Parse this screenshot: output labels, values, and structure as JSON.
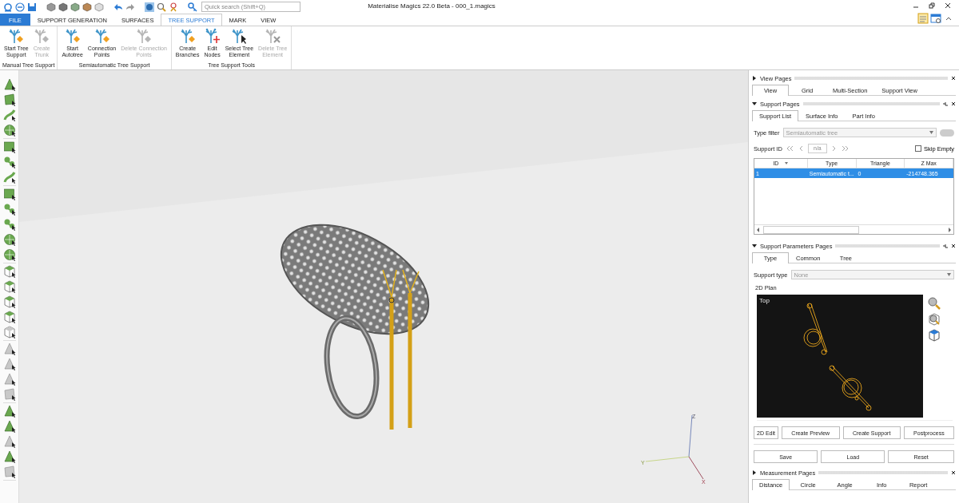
{
  "window": {
    "title": "Materialise Magics 22.0 Beta - 000_1.magics"
  },
  "quick_search": {
    "placeholder": "Quick search (Shift+Q)"
  },
  "ribbon_tabs": [
    {
      "label": "FILE",
      "selected": false,
      "kind": "file"
    },
    {
      "label": "SUPPORT GENERATION",
      "selected": false,
      "kind": "tab"
    },
    {
      "label": "SURFACES",
      "selected": false,
      "kind": "tab"
    },
    {
      "label": "TREE SUPPORT",
      "selected": true,
      "kind": "tab"
    },
    {
      "label": "MARK",
      "selected": false,
      "kind": "tab"
    },
    {
      "label": "VIEW",
      "selected": false,
      "kind": "tab"
    }
  ],
  "ribbon_groups": [
    {
      "label": "Manual Tree Support",
      "buttons": [
        {
          "label": "Start Tree\nSupport",
          "disabled": false,
          "kind": "add"
        },
        {
          "label": "Create\nTrunk",
          "disabled": true,
          "kind": "add"
        }
      ]
    },
    {
      "label": "Semiautomatic Tree Support",
      "buttons": [
        {
          "label": "Start\nAutotree",
          "disabled": false,
          "kind": "add"
        },
        {
          "label": "Connection\nPoints",
          "disabled": false,
          "kind": "add"
        },
        {
          "label": "Delete Connection\nPoints",
          "disabled": true,
          "kind": "add"
        }
      ]
    },
    {
      "label": "Tree Support Tools",
      "buttons": [
        {
          "label": "Create\nBranches",
          "disabled": false,
          "kind": "add"
        },
        {
          "label": "Edit\nNodes",
          "disabled": false,
          "kind": "edit"
        },
        {
          "label": "Select Tree\nElement",
          "disabled": false,
          "kind": "select"
        },
        {
          "label": "Delete Tree\nElement",
          "disabled": true,
          "kind": "delete"
        }
      ]
    }
  ],
  "left_toolbar": [
    [
      {
        "kind": "triangle",
        "disabled": false
      },
      {
        "kind": "quad",
        "disabled": false
      },
      {
        "kind": "curve",
        "disabled": false
      },
      {
        "kind": "circle",
        "disabled": false
      }
    ],
    [
      {
        "kind": "square",
        "disabled": false
      },
      {
        "kind": "node",
        "disabled": false
      },
      {
        "kind": "curve",
        "disabled": false
      }
    ],
    [
      {
        "kind": "square",
        "disabled": false
      },
      {
        "kind": "node",
        "disabled": false
      },
      {
        "kind": "node",
        "disabled": false
      },
      {
        "kind": "circle",
        "disabled": false
      },
      {
        "kind": "circle",
        "disabled": false
      }
    ],
    [
      {
        "kind": "cube",
        "disabled": false
      },
      {
        "kind": "cube",
        "disabled": false
      },
      {
        "kind": "cube",
        "disabled": false
      },
      {
        "kind": "cube",
        "disabled": false
      },
      {
        "kind": "cube",
        "disabled": true
      }
    ],
    [
      {
        "kind": "triangle",
        "disabled": true
      },
      {
        "kind": "triangle",
        "disabled": true
      },
      {
        "kind": "triangle",
        "disabled": true
      },
      {
        "kind": "quad",
        "disabled": true
      }
    ],
    [
      {
        "kind": "triangle",
        "disabled": false
      },
      {
        "kind": "triangle",
        "disabled": false
      },
      {
        "kind": "triangle",
        "disabled": true
      },
      {
        "kind": "triangle",
        "disabled": false
      },
      {
        "kind": "quad",
        "disabled": true
      }
    ]
  ],
  "viewport": {
    "axis_labels": {
      "z": "Z",
      "y": "Y",
      "x": "X"
    }
  },
  "view_pages": {
    "title": "View Pages",
    "expanded": false,
    "tabs": [
      {
        "label": "View",
        "selected": true
      },
      {
        "label": "Grid",
        "selected": false
      },
      {
        "label": "Multi-Section",
        "selected": false
      },
      {
        "label": "Support View",
        "selected": false
      }
    ]
  },
  "support_pages": {
    "title": "Support Pages",
    "expanded": true,
    "tabs": [
      {
        "label": "Support List",
        "selected": true
      },
      {
        "label": "Surface Info",
        "selected": false
      },
      {
        "label": "Part Info",
        "selected": false
      }
    ],
    "type_filter": {
      "label": "Type filter",
      "value": "Semiautomatic tree",
      "disabled": true,
      "toggle_on": false
    },
    "support_id": {
      "label": "Support ID",
      "value": "n/a"
    },
    "skip_empty": {
      "label": "Skip Empty",
      "checked": false
    },
    "table": {
      "columns": [
        "ID",
        "Type",
        "Triangle",
        "Z Max"
      ],
      "rows": [
        {
          "cells": [
            "1",
            "Semiautomatic t...",
            "0",
            "-214748.365"
          ],
          "selected": true
        }
      ]
    }
  },
  "support_parameters_pages": {
    "title": "Support Parameters Pages",
    "expanded": true,
    "tabs": [
      {
        "label": "Type",
        "selected": true
      },
      {
        "label": "Common",
        "selected": false
      },
      {
        "label": "Tree",
        "selected": false
      }
    ],
    "support_type": {
      "label": "Support type",
      "value": "None",
      "disabled": true
    },
    "plan": {
      "title": "2D Plan",
      "view_label": "Top"
    },
    "buttons_row_1": [
      "2D Edit",
      "Create Preview",
      "Create Support",
      "Postprocess"
    ],
    "buttons_row_2": [
      "Save",
      "Load",
      "Reset"
    ]
  },
  "measurement_pages": {
    "title": "Measurement Pages",
    "expanded": false,
    "tabs": [
      {
        "label": "Distance",
        "selected": true
      },
      {
        "label": "Circle",
        "selected": false
      },
      {
        "label": "Angle",
        "selected": false
      },
      {
        "label": "Info",
        "selected": false
      },
      {
        "label": "Report",
        "selected": false
      }
    ]
  }
}
